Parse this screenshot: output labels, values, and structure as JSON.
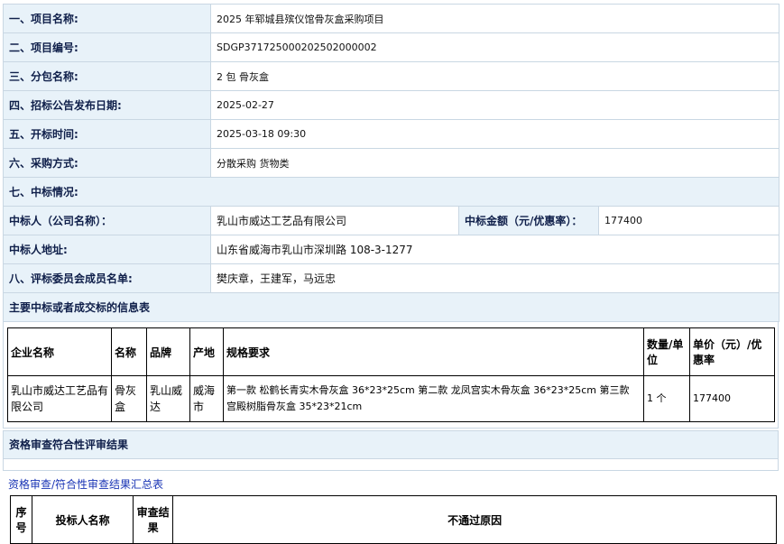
{
  "info_rows": [
    {
      "label": "一、项目名称:",
      "value": "2025 年郓城县殡仪馆骨灰盒采购项目"
    },
    {
      "label": "二、项目编号:",
      "value": "SDGP371725000202502000002"
    },
    {
      "label": "三、分包名称:",
      "value": "2 包 骨灰盒"
    },
    {
      "label": "四、招标公告发布日期:",
      "value": "2025-02-27"
    },
    {
      "label": "五、开标时间:",
      "value": "2025-03-18 09:30"
    },
    {
      "label": "六、采购方式:",
      "value": "分散采购 货物类"
    }
  ],
  "award_section": {
    "title": "七、中标情况:",
    "winner_label": "中标人（公司名称）：",
    "winner_value": "乳山市威达工艺品有限公司",
    "amount_label": "中标金额（元/优惠率）：",
    "amount_value": "177400",
    "address_label": "中标人地址:",
    "address_value": "山东省威海市乳山市深圳路 108-3-1277",
    "committee_label": "八、评标委员会成员名单:",
    "committee_value": "樊庆章，王建军，马远忠"
  },
  "main_info": {
    "title": "主要中标或者成交标的信息表",
    "headers": [
      "企业名称",
      "名称",
      "品牌",
      "产地",
      "规格要求",
      "数量/单位",
      "单价（元）/优惠率"
    ],
    "row": {
      "company": "乳山市威达工艺品有限公司",
      "name": "骨灰盒",
      "brand": "乳山威达",
      "origin": "威海市",
      "spec": "第一款 松鹤长青实木骨灰盒 36*23*25cm 第二款 龙凤宫实木骨灰盒 36*23*25cm 第三款 宫殿树脂骨灰盒 35*23*21cm",
      "qty": "1 个",
      "price": "177400"
    }
  },
  "qualification": {
    "title": "资格审查符合性评审结果",
    "link": "资格审查/符合性审查结果汇总表",
    "headers": [
      "序号",
      "投标人名称",
      "审查结果",
      "不通过原因"
    ]
  }
}
